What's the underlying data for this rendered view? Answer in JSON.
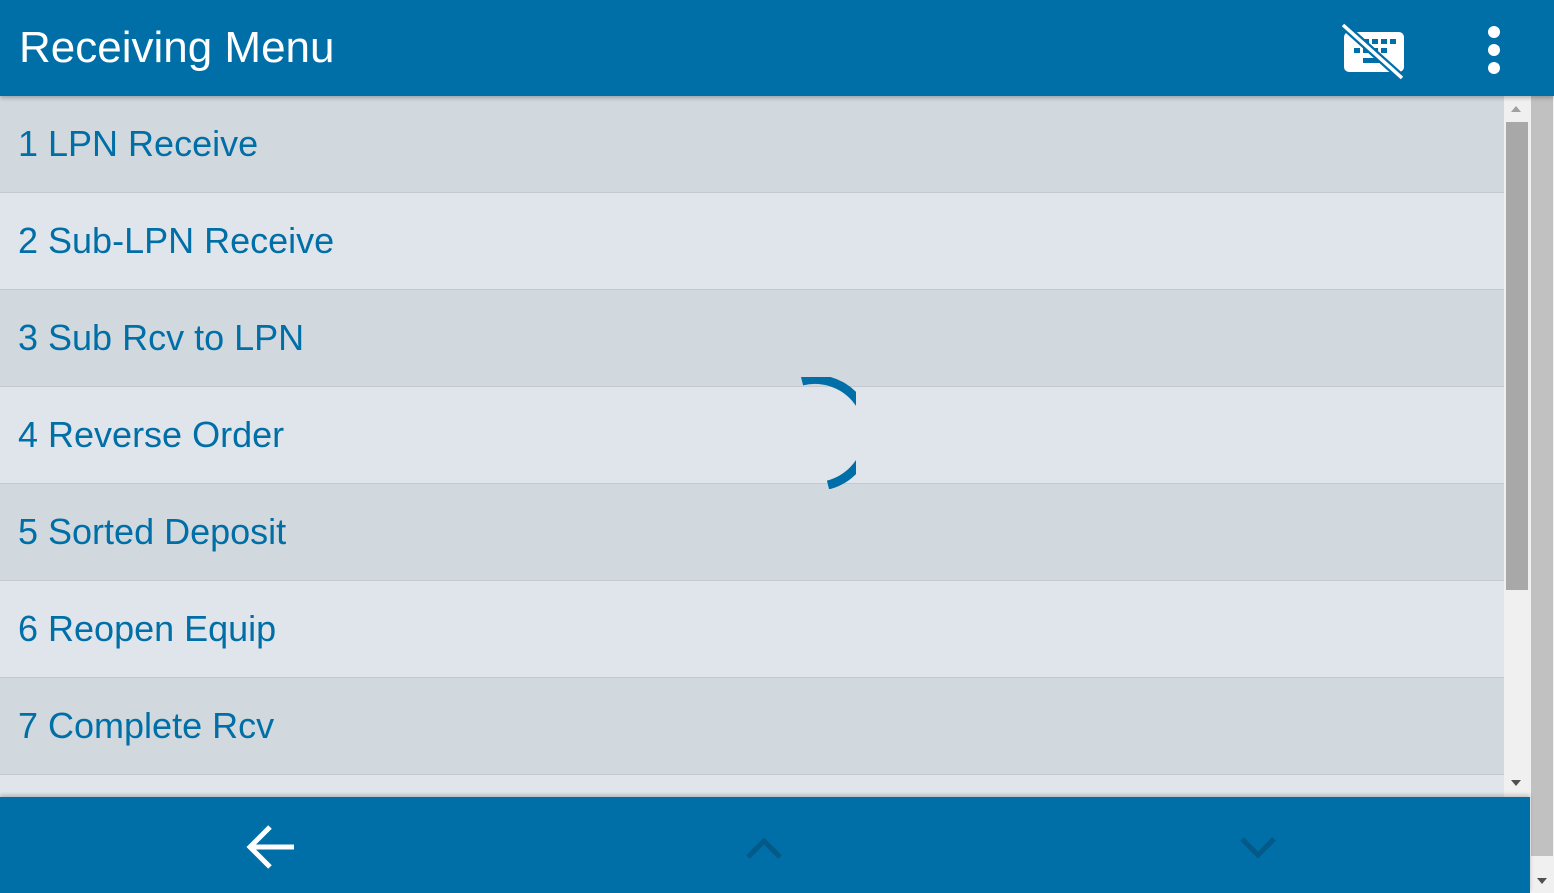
{
  "header": {
    "title": "Receiving Menu",
    "keyboard_icon": "keyboard-off-icon",
    "menu_icon": "more-vertical-icon"
  },
  "menu": {
    "items": [
      {
        "label": "1 LPN Receive"
      },
      {
        "label": "2 Sub-LPN Receive"
      },
      {
        "label": "3 Sub Rcv to LPN"
      },
      {
        "label": "4 Reverse Order"
      },
      {
        "label": "5 Sorted Deposit"
      },
      {
        "label": "6 Reopen Equip"
      },
      {
        "label": "7 Complete Rcv"
      },
      {
        "label": ""
      }
    ]
  },
  "footer": {
    "back_icon": "arrow-left-icon",
    "up_icon": "chevron-up-icon",
    "down_icon": "chevron-down-icon"
  },
  "colors": {
    "primary": "#006ea7",
    "row_odd": "#d1d9de",
    "row_even": "#dfe5ea",
    "text": "#006ea7"
  }
}
